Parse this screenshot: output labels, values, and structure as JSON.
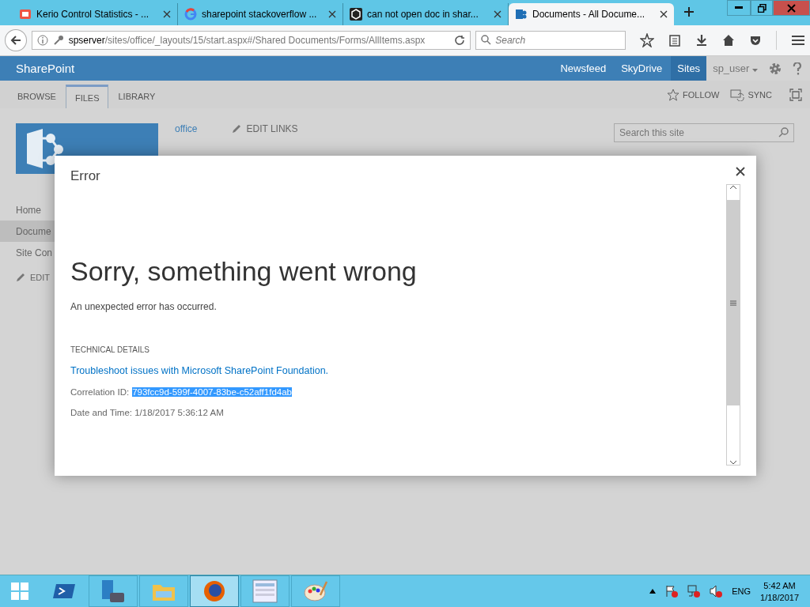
{
  "browser": {
    "tabs": [
      {
        "title": "Kerio Control Statistics - ...",
        "kind": "kerio",
        "selected": false
      },
      {
        "title": "sharepoint stackoverflow ...",
        "kind": "google",
        "selected": false
      },
      {
        "title": "can not open doc in shar...",
        "kind": "stack",
        "selected": false
      },
      {
        "title": "Documents - All Docume...",
        "kind": "sharepoint",
        "selected": true
      }
    ],
    "url_host": "spserver",
    "url_path": "/sites/office/_layouts/15/start.aspx#/Shared Documents/Forms/AllItems.aspx",
    "search": {
      "placeholder": "Search"
    }
  },
  "suite_bar": {
    "brand": "SharePoint",
    "links": [
      {
        "label": "Newsfeed",
        "selected": false
      },
      {
        "label": "SkyDrive",
        "selected": false
      },
      {
        "label": "Sites",
        "selected": true
      }
    ],
    "user": "sp_user"
  },
  "ribbon": {
    "tabs": [
      {
        "label": "BROWSE",
        "selected": false
      },
      {
        "label": "FILES",
        "selected": true
      },
      {
        "label": "LIBRARY",
        "selected": false
      }
    ],
    "actions": [
      {
        "label": "FOLLOW",
        "kind": "follow"
      },
      {
        "label": "SYNC",
        "kind": "sync"
      }
    ]
  },
  "site": {
    "breadcrumb": "office",
    "edit_links": "EDIT LINKS",
    "search": {
      "placeholder": "Search this site"
    },
    "nav": [
      {
        "label": "Home",
        "selected": false
      },
      {
        "label": "Docume",
        "selected": true
      },
      {
        "label": "Site Con",
        "selected": false
      }
    ],
    "edit": "EDIT"
  },
  "dialog": {
    "title": "Error",
    "heading": "Sorry, something went wrong",
    "message": "An unexpected error has occurred.",
    "details_heading": "TECHNICAL DETAILS",
    "link": "Troubleshoot issues with Microsoft SharePoint Foundation.",
    "correlation": {
      "label": "Correlation ID:",
      "value": "793fcc9d-599f-4007-83be-c52aff1fd4ab",
      "selected": true
    },
    "date": "Date and Time: 1/18/2017 5:36:12 AM"
  },
  "taskbar": {
    "apps": [
      {
        "kind": "powershell",
        "selected": false
      },
      {
        "kind": "server",
        "selected": false
      },
      {
        "kind": "folder",
        "selected": false
      },
      {
        "kind": "firefox",
        "selected": true
      },
      {
        "kind": "table",
        "selected": false
      },
      {
        "kind": "paint",
        "selected": false
      }
    ],
    "language": "ENG",
    "time": "5:42 AM",
    "date": "1/18/2017"
  }
}
